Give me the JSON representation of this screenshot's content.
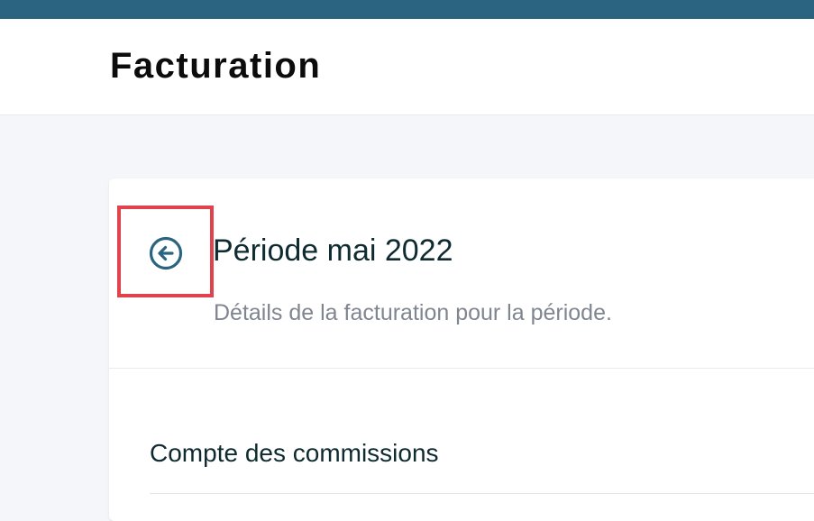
{
  "header": {
    "title": "Facturation"
  },
  "card": {
    "back_icon": "arrow-left-circle-icon",
    "period_title": "Période mai 2022",
    "period_subtitle": "Détails de la facturation pour la période.",
    "section_title": "Compte des commissions"
  },
  "colors": {
    "top_bar": "#2b6480",
    "accent": "#2b6480",
    "highlight": "#e0434d",
    "title_text": "#0f2a30",
    "muted_text": "#7f8690"
  }
}
